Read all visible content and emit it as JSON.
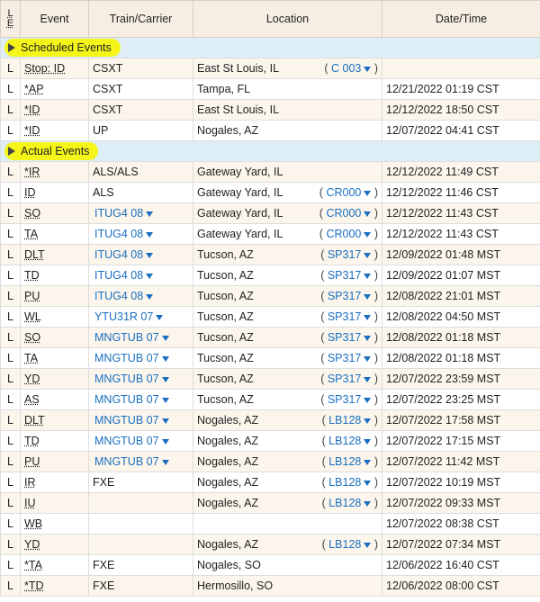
{
  "columns": {
    "le_l": "L",
    "le_e": "E",
    "event": "Event",
    "train": "Train/Carrier",
    "location": "Location",
    "datetime": "Date/Time"
  },
  "sections": {
    "scheduled": "Scheduled Events",
    "actual": "Actual Events"
  },
  "scheduled_rows": [
    {
      "le": "L",
      "event": "Stop: ID",
      "carrier": "CSXT",
      "carrier_link": false,
      "location": "East St Louis, IL",
      "code": "C 003",
      "datetime": ""
    },
    {
      "le": "L",
      "event": "*AP",
      "carrier": "CSXT",
      "carrier_link": false,
      "location": "Tampa, FL",
      "code": "",
      "datetime": "12/21/2022 01:19 CST"
    },
    {
      "le": "L",
      "event": "*ID",
      "carrier": "CSXT",
      "carrier_link": false,
      "location": "East St Louis, IL",
      "code": "",
      "datetime": "12/12/2022 18:50 CST"
    },
    {
      "le": "L",
      "event": "*ID",
      "carrier": "UP",
      "carrier_link": false,
      "location": "Nogales, AZ",
      "code": "",
      "datetime": "12/07/2022 04:41 CST"
    }
  ],
  "actual_rows": [
    {
      "le": "L",
      "event": "*IR",
      "carrier": "ALS/ALS",
      "carrier_link": false,
      "location": "Gateway Yard, IL",
      "code": "",
      "datetime": "12/12/2022 11:49 CST"
    },
    {
      "le": "L",
      "event": "ID",
      "carrier": "ALS",
      "carrier_link": false,
      "location": "Gateway Yard, IL",
      "code": "CR000",
      "datetime": "12/12/2022 11:46 CST"
    },
    {
      "le": "L",
      "event": "SO",
      "carrier": "ITUG4 08",
      "carrier_link": true,
      "location": "Gateway Yard, IL",
      "code": "CR000",
      "datetime": "12/12/2022 11:43 CST"
    },
    {
      "le": "L",
      "event": "TA",
      "carrier": "ITUG4 08",
      "carrier_link": true,
      "location": "Gateway Yard, IL",
      "code": "CR000",
      "datetime": "12/12/2022 11:43 CST"
    },
    {
      "le": "L",
      "event": "DLT",
      "carrier": "ITUG4 08",
      "carrier_link": true,
      "location": "Tucson, AZ",
      "code": "SP317",
      "datetime": "12/09/2022 01:48 MST"
    },
    {
      "le": "L",
      "event": "TD",
      "carrier": "ITUG4 08",
      "carrier_link": true,
      "location": "Tucson, AZ",
      "code": "SP317",
      "datetime": "12/09/2022 01:07 MST"
    },
    {
      "le": "L",
      "event": "PU",
      "carrier": "ITUG4 08",
      "carrier_link": true,
      "location": "Tucson, AZ",
      "code": "SP317",
      "datetime": "12/08/2022 21:01 MST"
    },
    {
      "le": "L",
      "event": "WL",
      "carrier": "YTU31R 07",
      "carrier_link": true,
      "location": "Tucson, AZ",
      "code": "SP317",
      "datetime": "12/08/2022 04:50 MST"
    },
    {
      "le": "L",
      "event": "SO",
      "carrier": "MNGTUB 07",
      "carrier_link": true,
      "location": "Tucson, AZ",
      "code": "SP317",
      "datetime": "12/08/2022 01:18 MST"
    },
    {
      "le": "L",
      "event": "TA",
      "carrier": "MNGTUB 07",
      "carrier_link": true,
      "location": "Tucson, AZ",
      "code": "SP317",
      "datetime": "12/08/2022 01:18 MST"
    },
    {
      "le": "L",
      "event": "YD",
      "carrier": "MNGTUB 07",
      "carrier_link": true,
      "location": "Tucson, AZ",
      "code": "SP317",
      "datetime": "12/07/2022 23:59 MST"
    },
    {
      "le": "L",
      "event": "AS",
      "carrier": "MNGTUB 07",
      "carrier_link": true,
      "location": "Tucson, AZ",
      "code": "SP317",
      "datetime": "12/07/2022 23:25 MST"
    },
    {
      "le": "L",
      "event": "DLT",
      "carrier": "MNGTUB 07",
      "carrier_link": true,
      "location": "Nogales, AZ",
      "code": "LB128",
      "datetime": "12/07/2022 17:58 MST"
    },
    {
      "le": "L",
      "event": "TD",
      "carrier": "MNGTUB 07",
      "carrier_link": true,
      "location": "Nogales, AZ",
      "code": "LB128",
      "datetime": "12/07/2022 17:15 MST"
    },
    {
      "le": "L",
      "event": "PU",
      "carrier": "MNGTUB 07",
      "carrier_link": true,
      "location": "Nogales, AZ",
      "code": "LB128",
      "datetime": "12/07/2022 11:42 MST"
    },
    {
      "le": "L",
      "event": "IR",
      "carrier": "FXE",
      "carrier_link": false,
      "location": "Nogales, AZ",
      "code": "LB128",
      "datetime": "12/07/2022 10:19 MST"
    },
    {
      "le": "L",
      "event": "IU",
      "carrier": "",
      "carrier_link": false,
      "location": "Nogales, AZ",
      "code": "LB128",
      "datetime": "12/07/2022 09:33 MST"
    },
    {
      "le": "L",
      "event": "WB",
      "carrier": "",
      "carrier_link": false,
      "location": "",
      "code": "",
      "datetime": "12/07/2022 08:38 CST"
    },
    {
      "le": "L",
      "event": "YD",
      "carrier": "",
      "carrier_link": false,
      "location": "Nogales, AZ",
      "code": "LB128",
      "datetime": "12/07/2022 07:34 MST"
    },
    {
      "le": "L",
      "event": "*TA",
      "carrier": "FXE",
      "carrier_link": false,
      "location": "Nogales, SO",
      "code": "",
      "datetime": "12/06/2022 16:40 CST"
    },
    {
      "le": "L",
      "event": "*TD",
      "carrier": "FXE",
      "carrier_link": false,
      "location": "Hermosillo, SO",
      "code": "",
      "datetime": "12/06/2022 08:00 CST"
    }
  ],
  "colors": {
    "header_bg": "#f6eee2",
    "odd_row": "#fbf5ec",
    "section_bg": "#ddeef6",
    "highlight": "#f5f51a",
    "link": "#1a6fc0"
  }
}
